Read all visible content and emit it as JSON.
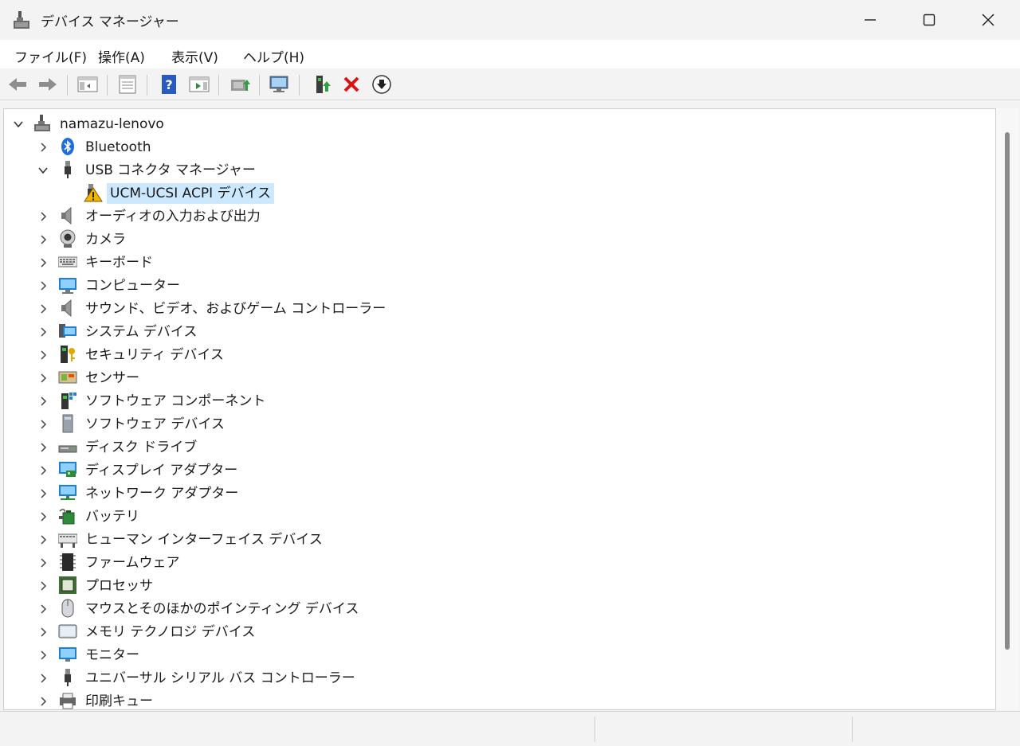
{
  "window": {
    "title": "デバイス マネージャー"
  },
  "menu": [
    "ファイル(F)",
    "操作(A)",
    "表示(V)",
    "ヘルプ(H)"
  ],
  "toolbar": [
    "back-arrow-icon",
    "forward-arrow-icon",
    "show-hide-console-tree-icon",
    "properties-icon",
    "help-icon",
    "action-pane-icon",
    "update-driver-icon",
    "scan-hardware-icon",
    "add-legacy-hardware-icon",
    "disable-device-icon",
    "uninstall-device-icon"
  ],
  "tree": {
    "root": "namazu-lenovo",
    "items": [
      {
        "label": "Bluetooth",
        "icon": "bluetooth-icon",
        "expanded": false
      },
      {
        "label": "USB コネクタ マネージャー",
        "icon": "usb-connector-icon",
        "expanded": true,
        "children": [
          {
            "label": "UCM-UCSI ACPI デバイス",
            "icon": "warning-icon",
            "selected": true
          }
        ]
      },
      {
        "label": "オーディオの入力および出力",
        "icon": "speaker-icon",
        "expanded": false
      },
      {
        "label": "カメラ",
        "icon": "camera-icon",
        "expanded": false
      },
      {
        "label": "キーボード",
        "icon": "keyboard-icon",
        "expanded": false
      },
      {
        "label": "コンピューター",
        "icon": "computer-icon",
        "expanded": false
      },
      {
        "label": "サウンド、ビデオ、およびゲーム コントローラー",
        "icon": "speaker-icon",
        "expanded": false
      },
      {
        "label": "システム デバイス",
        "icon": "system-device-icon",
        "expanded": false
      },
      {
        "label": "セキュリティ デバイス",
        "icon": "security-key-icon",
        "expanded": false
      },
      {
        "label": "センサー",
        "icon": "sensor-icon",
        "expanded": false
      },
      {
        "label": "ソフトウェア コンポーネント",
        "icon": "software-component-icon",
        "expanded": false
      },
      {
        "label": "ソフトウェア デバイス",
        "icon": "software-device-icon",
        "expanded": false
      },
      {
        "label": "ディスク ドライブ",
        "icon": "disk-drive-icon",
        "expanded": false
      },
      {
        "label": "ディスプレイ アダプター",
        "icon": "display-adapter-icon",
        "expanded": false
      },
      {
        "label": "ネットワーク アダプター",
        "icon": "network-adapter-icon",
        "expanded": false
      },
      {
        "label": "バッテリ",
        "icon": "battery-icon",
        "expanded": false
      },
      {
        "label": "ヒューマン インターフェイス デバイス",
        "icon": "hid-icon",
        "expanded": false
      },
      {
        "label": "ファームウェア",
        "icon": "firmware-chip-icon",
        "expanded": false
      },
      {
        "label": "プロセッサ",
        "icon": "processor-icon",
        "expanded": false
      },
      {
        "label": "マウスとそのほかのポインティング デバイス",
        "icon": "mouse-icon",
        "expanded": false
      },
      {
        "label": "メモリ テクノロジ デバイス",
        "icon": "memory-device-icon",
        "expanded": false
      },
      {
        "label": "モニター",
        "icon": "monitor-icon",
        "expanded": false
      },
      {
        "label": "ユニバーサル シリアル バス コントローラー",
        "icon": "usb-icon",
        "expanded": false
      },
      {
        "label": "印刷キュー",
        "icon": "printer-icon",
        "expanded": false
      }
    ]
  }
}
